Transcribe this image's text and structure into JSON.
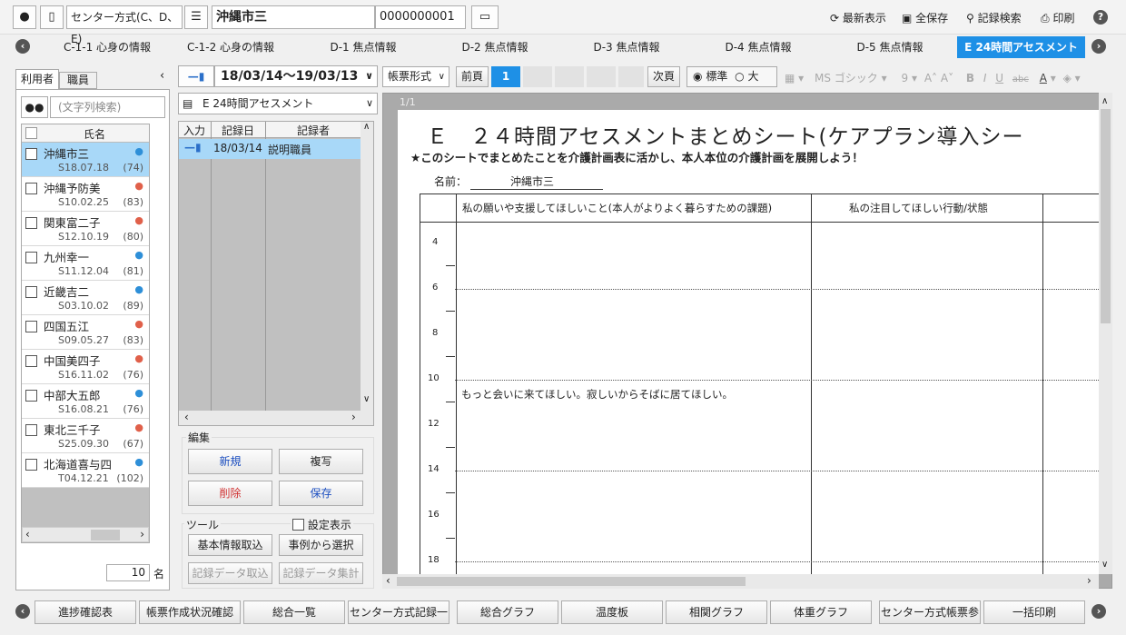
{
  "header": {
    "method_label": "センター方式(C、D、E)",
    "person_name": "沖縄市三",
    "person_id": "0000000001",
    "actions": [
      "最新表示",
      "全保存",
      "記録検索",
      "印刷"
    ],
    "help": "?"
  },
  "tabs": [
    "C-1-1 心身の情報",
    "C-1-2 心身の情報",
    "D-1 焦点情報",
    "D-2 焦点情報",
    "D-3 焦点情報",
    "D-4 焦点情報",
    "D-5 焦点情報",
    "E 24時間アセスメント"
  ],
  "left": {
    "tab_users": "利用者",
    "tab_staff": "職員",
    "search_placeholder": "(文字列検索)",
    "col_name": "氏名",
    "people": [
      {
        "name": "沖縄市三",
        "date": "S18.07.18",
        "age": "(74)",
        "sex": "male"
      },
      {
        "name": "沖縄予防美",
        "date": "S10.02.25",
        "age": "(83)",
        "sex": "female"
      },
      {
        "name": "関東富二子",
        "date": "S12.10.19",
        "age": "(80)",
        "sex": "female"
      },
      {
        "name": "九州幸一",
        "date": "S11.12.04",
        "age": "(81)",
        "sex": "male"
      },
      {
        "name": "近畿吉二",
        "date": "S03.10.02",
        "age": "(89)",
        "sex": "male"
      },
      {
        "name": "四国五江",
        "date": "S09.05.27",
        "age": "(83)",
        "sex": "female"
      },
      {
        "name": "中国美四子",
        "date": "S16.11.02",
        "age": "(76)",
        "sex": "female"
      },
      {
        "name": "中部大五郎",
        "date": "S16.08.21",
        "age": "(76)",
        "sex": "male"
      },
      {
        "name": "東北三千子",
        "date": "S25.09.30",
        "age": "(67)",
        "sex": "female"
      },
      {
        "name": "北海道喜与四",
        "date": "T04.12.21",
        "age": "(102)",
        "sex": "male"
      }
    ],
    "count": "10",
    "count_unit": "名"
  },
  "middle": {
    "date_range": "18/03/14～19/03/13",
    "sheet_select": "E 24時間アセスメント",
    "cols": [
      "入力",
      "記録日",
      "記録者"
    ],
    "record": {
      "date": "18/03/14",
      "author": "説明職員"
    },
    "edit_label": "編集",
    "btn_new": "新規",
    "btn_copy": "複写",
    "btn_delete": "削除",
    "btn_save": "保存",
    "tool_label": "ツール",
    "settings_label": "設定表示",
    "btn_basic": "基本情報取込",
    "btn_case": "事例から選択",
    "btn_import": "記録データ取込",
    "btn_aggregate": "記録データ集計"
  },
  "toolbar": {
    "format": "帳票形式",
    "prev": "前頁",
    "page": "1",
    "next": "次頁",
    "size_std": "標準",
    "size_large": "大",
    "font": "MS ゴシック",
    "font_size": "9"
  },
  "doc": {
    "page_indicator": "1/1",
    "title": "Ｅ　２４時間アセスメントまとめシート(ケアプラン導入シー",
    "subtitle": "★このシートでまとめたことを介護計画表に活かし、本人本位の介護計画を展開しよう！",
    "name_label": "名前：",
    "name_value": "沖縄市三",
    "col1": "私の願いや支援してほしいこと(本人がよりよく暮らすための課題)",
    "col2": "私の注目してほしい行動/状態",
    "hours": [
      "4",
      "6",
      "8",
      "10",
      "12",
      "14",
      "16",
      "18"
    ],
    "entry": "もっと会いに来てほしい。寂しいからそばに居てほしい。"
  },
  "bottom": [
    "進捗確認表",
    "帳票作成状況確認",
    "総合一覧",
    "センター方式記録一",
    "総合グラフ",
    "温度板",
    "相関グラフ",
    "体重グラフ",
    "センター方式帳票参",
    "一括印刷"
  ]
}
